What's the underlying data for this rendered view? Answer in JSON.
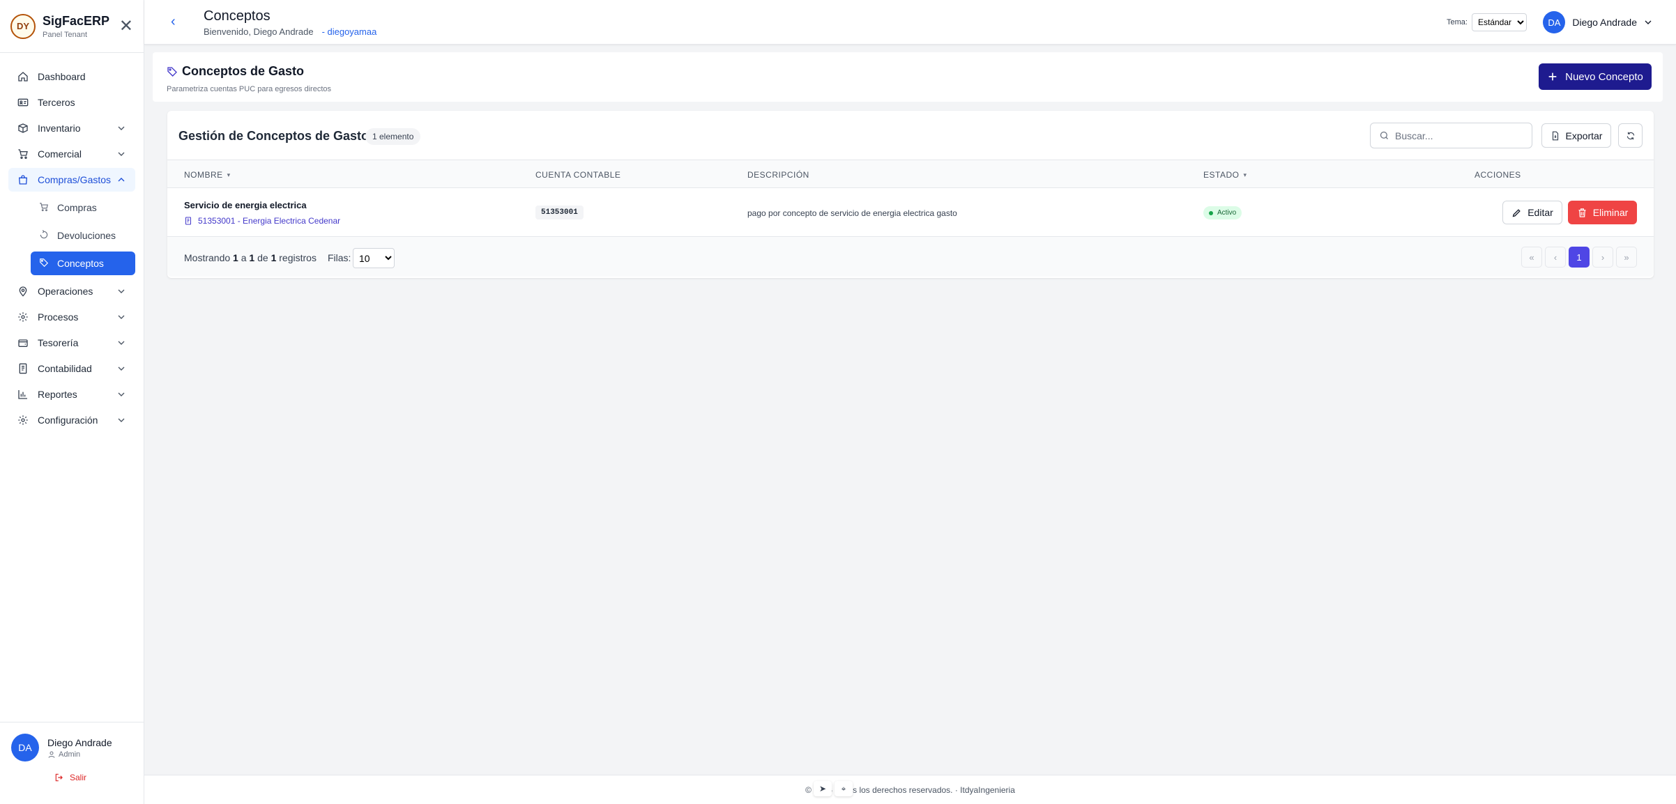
{
  "brand": {
    "logo_text": "DY",
    "app_name": "SigFacERP",
    "subtitle": "Panel Tenant"
  },
  "sidebar": {
    "items": [
      {
        "label": "Dashboard",
        "icon": "home-icon",
        "has_children": false
      },
      {
        "label": "Terceros",
        "icon": "id-card-icon",
        "has_children": false
      },
      {
        "label": "Inventario",
        "icon": "box-icon",
        "has_children": true
      },
      {
        "label": "Comercial",
        "icon": "cart-icon",
        "has_children": true
      },
      {
        "label": "Compras/Gastos",
        "icon": "shopping-bag-icon",
        "has_children": true,
        "expanded": true
      },
      {
        "label": "Operaciones",
        "icon": "map-pin-icon",
        "has_children": true
      },
      {
        "label": "Procesos",
        "icon": "gear-icon",
        "has_children": true
      },
      {
        "label": "Tesorería",
        "icon": "wallet-icon",
        "has_children": true
      },
      {
        "label": "Contabilidad",
        "icon": "ledger-icon",
        "has_children": true
      },
      {
        "label": "Reportes",
        "icon": "bar-chart-icon",
        "has_children": true
      },
      {
        "label": "Configuración",
        "icon": "gear-icon",
        "has_children": true
      }
    ],
    "sub_items": [
      {
        "label": "Compras",
        "icon": "cart-icon"
      },
      {
        "label": "Devoluciones",
        "icon": "undo-icon"
      },
      {
        "label": "Conceptos",
        "icon": "tag-icon",
        "active": true
      }
    ],
    "user": {
      "initials": "DA",
      "name": "Diego Andrade",
      "role": "Admin"
    },
    "logout_label": "Salir"
  },
  "header": {
    "title": "Conceptos",
    "welcome": "Bienvenido, Diego Andrade",
    "tenant": "- diegoyamaa",
    "theme_label": "Tema:",
    "theme_value": "Estándar",
    "user_initials": "DA",
    "user_name": "Diego Andrade"
  },
  "section": {
    "title": "Conceptos de Gasto",
    "description": "Parametriza cuentas PUC para egresos directos",
    "new_button": "Nuevo Concepto"
  },
  "table": {
    "title": "Gestión de Conceptos de Gasto",
    "count_badge": "1 elemento",
    "search_placeholder": "Buscar...",
    "export_label": "Exportar",
    "columns": {
      "name": "NOMBRE",
      "account": "CUENTA CONTABLE",
      "description": "DESCRIPCIÓN",
      "status": "ESTADO",
      "actions": "ACCIONES"
    },
    "rows": [
      {
        "name": "Servicio de energia electrica",
        "account_ref": "51353001 - Energia Electrica Cedenar",
        "account_code": "51353001",
        "description": "pago por concepto de servicio de energia electrica gasto",
        "status": "Activo",
        "edit_label": "Editar",
        "delete_label": "Eliminar"
      }
    ],
    "footer": {
      "showing_prefix": "Mostrando",
      "from": "1",
      "a": "a",
      "to": "1",
      "de": "de",
      "total": "1",
      "suffix": "registros",
      "rows_label": "Filas:",
      "rows_value": "10",
      "current_page": "1"
    }
  },
  "footer": {
    "text": "© 2026 Todos los derechos reservados. · ItdyaIngenieria"
  },
  "colors": {
    "primary": "#2563eb",
    "new_button": "#1e1b8f",
    "danger": "#ef4444",
    "active_badge": "#dcfce7",
    "page_current": "#4f46e5"
  }
}
